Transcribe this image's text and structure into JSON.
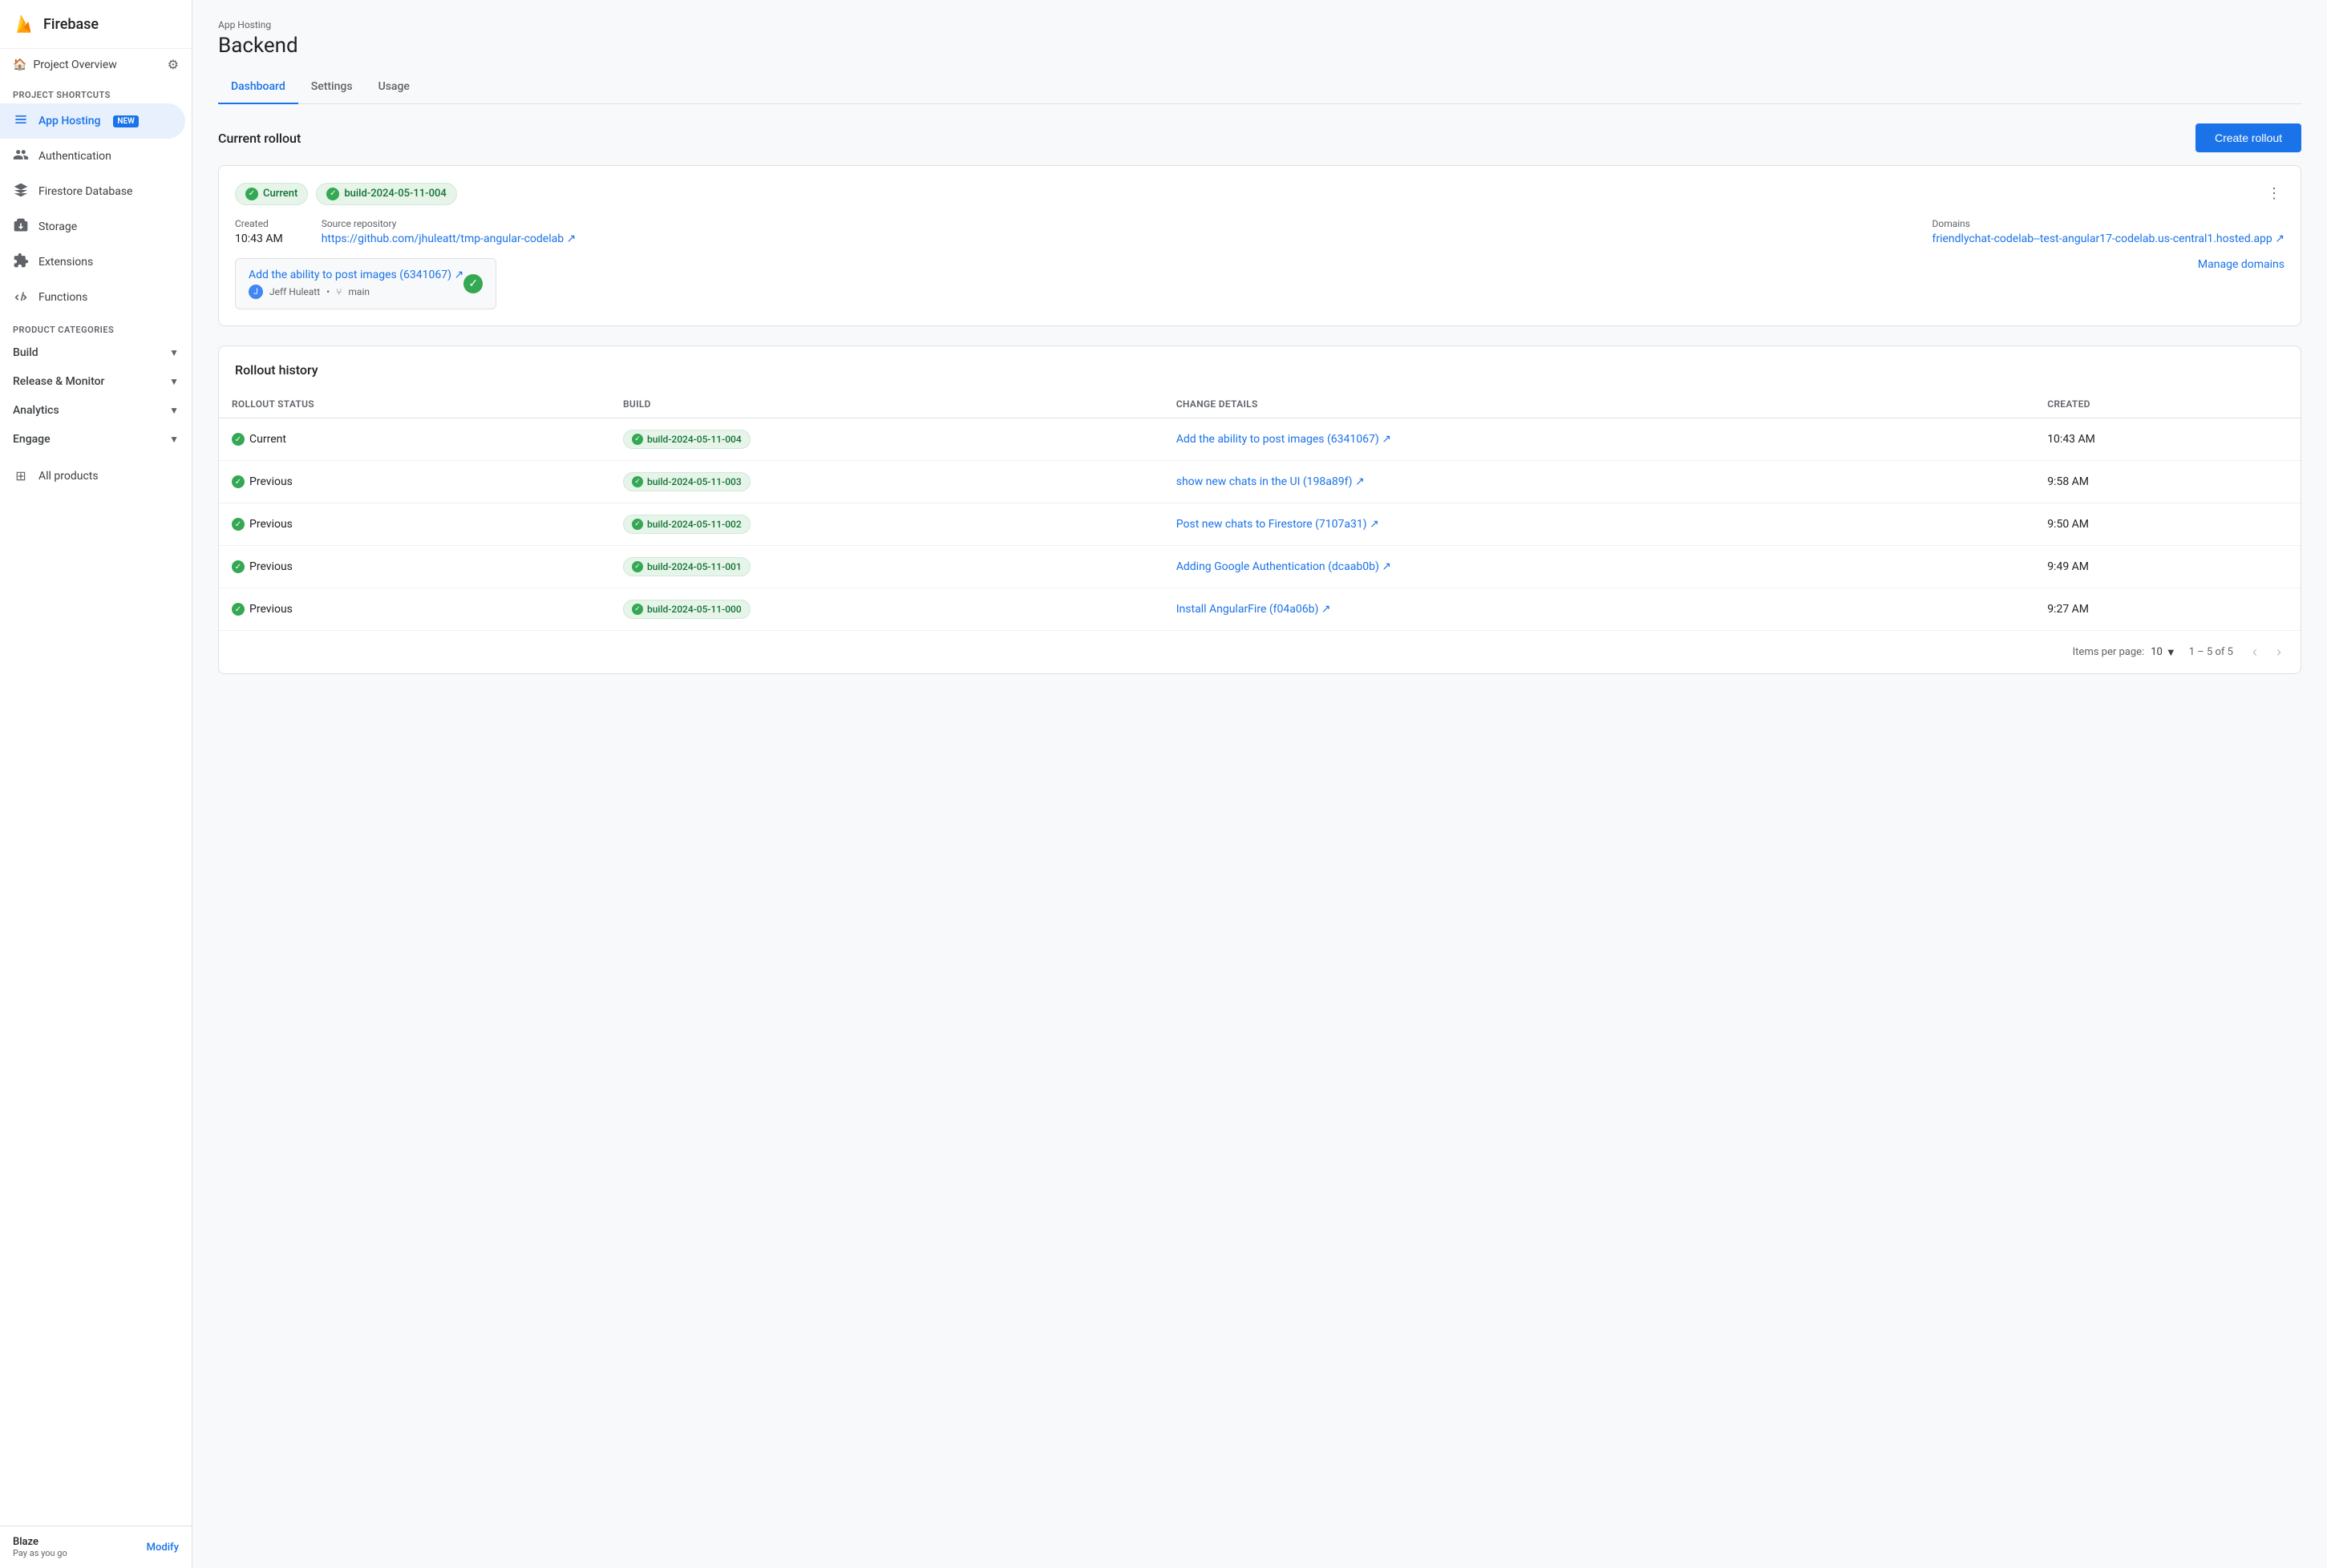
{
  "app": {
    "name": "Firebase"
  },
  "sidebar": {
    "project_overview": "Project Overview",
    "project_shortcuts_label": "Project shortcuts",
    "product_categories_label": "Product categories",
    "items": [
      {
        "id": "app-hosting",
        "label": "App Hosting",
        "badge": "NEW",
        "active": true
      },
      {
        "id": "authentication",
        "label": "Authentication"
      },
      {
        "id": "firestore",
        "label": "Firestore Database"
      },
      {
        "id": "storage",
        "label": "Storage"
      },
      {
        "id": "extensions",
        "label": "Extensions"
      },
      {
        "id": "functions",
        "label": "Functions"
      }
    ],
    "categories": [
      {
        "id": "build",
        "label": "Build"
      },
      {
        "id": "release-monitor",
        "label": "Release & Monitor"
      },
      {
        "id": "analytics",
        "label": "Analytics"
      },
      {
        "id": "engage",
        "label": "Engage"
      }
    ],
    "all_products": "All products",
    "footer": {
      "plan": "Blaze",
      "sub": "Pay as you go",
      "modify": "Modify"
    }
  },
  "header": {
    "subtitle": "App Hosting",
    "title": "Backend"
  },
  "tabs": [
    {
      "id": "dashboard",
      "label": "Dashboard",
      "active": true
    },
    {
      "id": "settings",
      "label": "Settings"
    },
    {
      "id": "usage",
      "label": "Usage"
    }
  ],
  "current_rollout": {
    "section_title": "Current rollout",
    "create_btn": "Create rollout",
    "status_chip": "Current",
    "build_chip": "build-2024-05-11-004",
    "created_label": "Created",
    "created_value": "10:43 AM",
    "source_label": "Source repository",
    "source_link": "https://github.com/jhuleatt/tmp-angular-codelab",
    "source_display": "https://github.com/jhuleatt/tmp-angular-codelab ↗",
    "domains_label": "Domains",
    "domain_link": "friendlychat-codelab--test-angular17-codelab.us-central1.hosted.app ↗",
    "domain_href": "friendlychat-codelab--test-angular17-codelab.us-central1.hosted.app",
    "commit_title": "Add the ability to post images (6341067) ↗",
    "commit_author": "Jeff Huleatt",
    "commit_branch": "main",
    "manage_domains": "Manage domains"
  },
  "rollout_history": {
    "title": "Rollout history",
    "columns": [
      {
        "id": "status",
        "label": "Rollout Status"
      },
      {
        "id": "build",
        "label": "Build"
      },
      {
        "id": "change",
        "label": "Change details"
      },
      {
        "id": "created",
        "label": "Created"
      }
    ],
    "rows": [
      {
        "status": "Current",
        "build": "build-2024-05-11-004",
        "change": "Add the ability to post images (6341067) ↗",
        "created": "10:43 AM"
      },
      {
        "status": "Previous",
        "build": "build-2024-05-11-003",
        "change": "show new chats in the UI (198a89f) ↗",
        "created": "9:58 AM"
      },
      {
        "status": "Previous",
        "build": "build-2024-05-11-002",
        "change": "Post new chats to Firestore (7107a31) ↗",
        "created": "9:50 AM"
      },
      {
        "status": "Previous",
        "build": "build-2024-05-11-001",
        "change": "Adding Google Authentication (dcaab0b) ↗",
        "created": "9:49 AM"
      },
      {
        "status": "Previous",
        "build": "build-2024-05-11-000",
        "change": "Install AngularFire (f04a06b) ↗",
        "created": "9:27 AM"
      }
    ],
    "pagination": {
      "items_per_page_label": "Items per page:",
      "per_page": "10",
      "page_info": "1 – 5 of 5"
    }
  }
}
